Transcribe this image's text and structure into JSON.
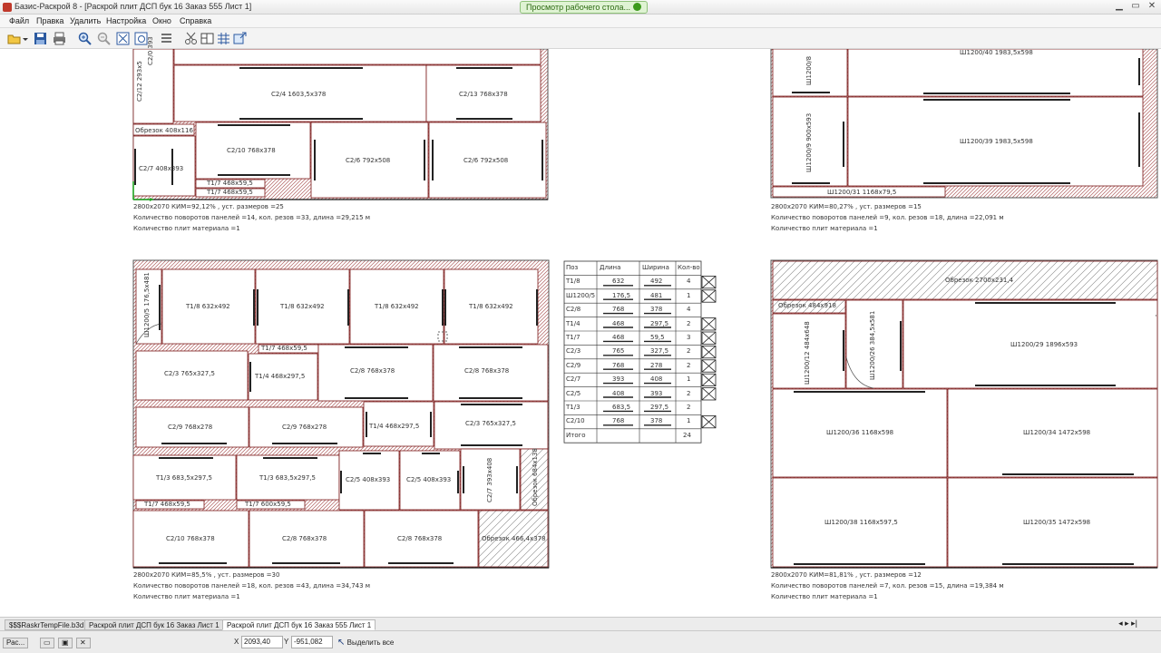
{
  "window": {
    "title": "Базис-Раскрой 8 - [Раскрой плит ДСП бук 16 Заказ 555 Лист 1]",
    "badge": "Просмотр рабочего стола..."
  },
  "menu": [
    "Файл",
    "Правка",
    "Удалить",
    "Настройка",
    "Окно",
    "Справка"
  ],
  "toolbar_icons": [
    "open-icon",
    "save-icon",
    "print-icon",
    "zoom-in-icon",
    "zoom-out-icon",
    "zoom-fit-icon",
    "zoom-window-icon",
    "list-icon",
    "cut-icon",
    "layout-icon",
    "grid-icon",
    "export-icon"
  ],
  "sheet1": {
    "parts": [
      {
        "l": "С2/4  1603,5x378"
      },
      {
        "l": "С2/13  768x378"
      },
      {
        "l": "Обрезок 408x116"
      },
      {
        "l": "С2/10  768x378"
      },
      {
        "l": "С2/6  792x508"
      },
      {
        "l": "С2/6  792x508"
      },
      {
        "l": "С2/7  408x393"
      },
      {
        "l": "Т1/7  468x59,5"
      },
      {
        "l": "Т1/7  468x59,5"
      },
      {
        "l": "С2/12  293x5"
      },
      {
        "l": "С2/0 393"
      }
    ],
    "stats": [
      "2800x2070  КИМ=92,12% , уст. размеров =25",
      "Количество поворотов панелей =14, кол. резов =33, длина =29,215 м",
      "Количество плит материала =1"
    ]
  },
  "sheet2": {
    "parts": [
      {
        "l": "Ш1200/8"
      },
      {
        "l": "Ш1200/40  1983,5x598"
      },
      {
        "l": "Ш1200/9 900x593"
      },
      {
        "l": "Ш1200/39  1983,5x598"
      },
      {
        "l": "Ш1200/31  1168x79,5"
      }
    ],
    "stats": [
      "2800x2070  КИМ=80,27% , уст. размеров =15",
      "Количество поворотов панелей =9, кол. резов =18, длина =22,091 м",
      "Количество плит материала =1"
    ]
  },
  "sheet3": {
    "parts": [
      {
        "l": "Ш1200/5 176,5x481"
      },
      {
        "l": "Т1/8  632x492"
      },
      {
        "l": "Т1/8  632x492"
      },
      {
        "l": "Т1/8  632x492"
      },
      {
        "l": "Т1/8  632x492"
      },
      {
        "l": "Т1/7 468x59,5"
      },
      {
        "l": "С2/3  765x327,5"
      },
      {
        "l": "Т1/4  468x297,5"
      },
      {
        "l": "С2/8  768x378"
      },
      {
        "l": "С2/8  768x378"
      },
      {
        "l": "С2/9  768x278"
      },
      {
        "l": "С2/9  768x278"
      },
      {
        "l": "Т1/4  468x297,5"
      },
      {
        "l": "С2/3  765x327,5"
      },
      {
        "l": "Т1/3  683,5x297,5"
      },
      {
        "l": "Т1/3  683,5x297,5"
      },
      {
        "l": "С2/5  408x393"
      },
      {
        "l": "С2/5  408x393"
      },
      {
        "l": "С2/7  393x408"
      },
      {
        "l": "Обрезок 684x138"
      },
      {
        "l": "Т1/7  468x59,5"
      },
      {
        "l": "Т1/7  600x59,5"
      },
      {
        "l": "С2/10  768x378"
      },
      {
        "l": "С2/8  768x378"
      },
      {
        "l": "С2/8  768x378"
      },
      {
        "l": "Обрезок 466,4x378"
      }
    ],
    "stats": [
      "2800x2070  КИМ=85,5% , уст. размеров =30",
      "Количество поворотов панелей =18, кол. резов =43, длина =34,743 м",
      "Количество плит материала =1"
    ]
  },
  "sheet4": {
    "parts": [
      {
        "l": "Обрезок 2700x231,4"
      },
      {
        "l": "Обрезок 484x918"
      },
      {
        "l": "Ш1200/12 484x648"
      },
      {
        "l": "Ш1200/26 384,5x581"
      },
      {
        "l": "Ш1200/29  1896x593"
      },
      {
        "l": "Ш1200/36  1168x598"
      },
      {
        "l": "Ш1200/34  1472x598"
      },
      {
        "l": "Ш1200/38  1168x597,5"
      },
      {
        "l": "Ш1200/35  1472x598"
      }
    ],
    "stats": [
      "2800x2070  КИМ=81,81% , уст. размеров =12",
      "Количество поворотов панелей =7, кол. резов =15, длина =19,384 м",
      "Количество плит материала =1"
    ]
  },
  "table": {
    "headers": [
      "Поз",
      "Длина",
      "Ширина",
      "Кол-во"
    ],
    "rows": [
      [
        "Т1/8",
        "632",
        "492",
        "4"
      ],
      [
        "Ш1200/5",
        "176,5",
        "481",
        "1"
      ],
      [
        "С2/8",
        "768",
        "378",
        "4"
      ],
      [
        "Т1/4",
        "468",
        "297,5",
        "2"
      ],
      [
        "Т1/7",
        "468",
        "59,5",
        "3"
      ],
      [
        "С2/3",
        "765",
        "327,5",
        "2"
      ],
      [
        "С2/9",
        "768",
        "278",
        "2"
      ],
      [
        "С2/7",
        "393",
        "408",
        "1"
      ],
      [
        "С2/5",
        "408",
        "393",
        "2"
      ],
      [
        "Т1/3",
        "683,5",
        "297,5",
        "2"
      ],
      [
        "С2/10",
        "768",
        "378",
        "1"
      ]
    ],
    "total_label": "Итого",
    "total": "24"
  },
  "tabs": [
    "$$$RaskrTempFile.b3d",
    "Раскрой плит ДСП бук 16 Заказ  Лист 1",
    "Раскрой плит ДСП бук 16 Заказ 555 Лист 1"
  ],
  "status": {
    "x_label": "X",
    "x": "2093,40",
    "y_label": "Y",
    "y": "-951,082",
    "select_all": "Выделить все",
    "task": "Рас..."
  },
  "colors": {
    "cut": "#7a1a1a",
    "waste_hatch": "#c98a8a",
    "border": "#555555"
  }
}
